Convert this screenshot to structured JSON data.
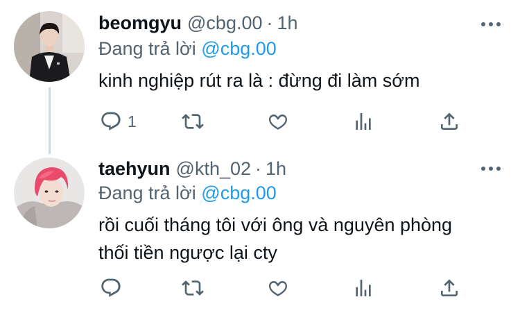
{
  "tweets": [
    {
      "name": "beomgyu",
      "handle": "@cbg.00",
      "dot": "·",
      "time": "1h",
      "reply_prefix": "Đang trả lời",
      "reply_mention": "@cbg.00",
      "text_lines": [
        "kinh nghiệp rút ra là : đừng đi làm sớm"
      ],
      "reply_count": "1"
    },
    {
      "name": "taehyun",
      "handle": "@kth_02",
      "dot": "·",
      "time": "1h",
      "reply_prefix": "Đang trả lời",
      "reply_mention": "@cbg.00",
      "text_lines": [
        "rồi cuối tháng tôi với ông và nguyên phòng",
        "thối tiền ngược lại cty"
      ],
      "reply_count": ""
    }
  ],
  "icons": {
    "reply": "reply-icon",
    "retweet": "retweet-icon",
    "like": "heart-icon",
    "stats": "stats-icon",
    "share": "share-icon",
    "more": "more-icon"
  },
  "colors": {
    "mention": "#1d9bf0",
    "secondary_text": "#536471",
    "primary_text": "#0f1419",
    "thread_line": "#cfd9de"
  }
}
